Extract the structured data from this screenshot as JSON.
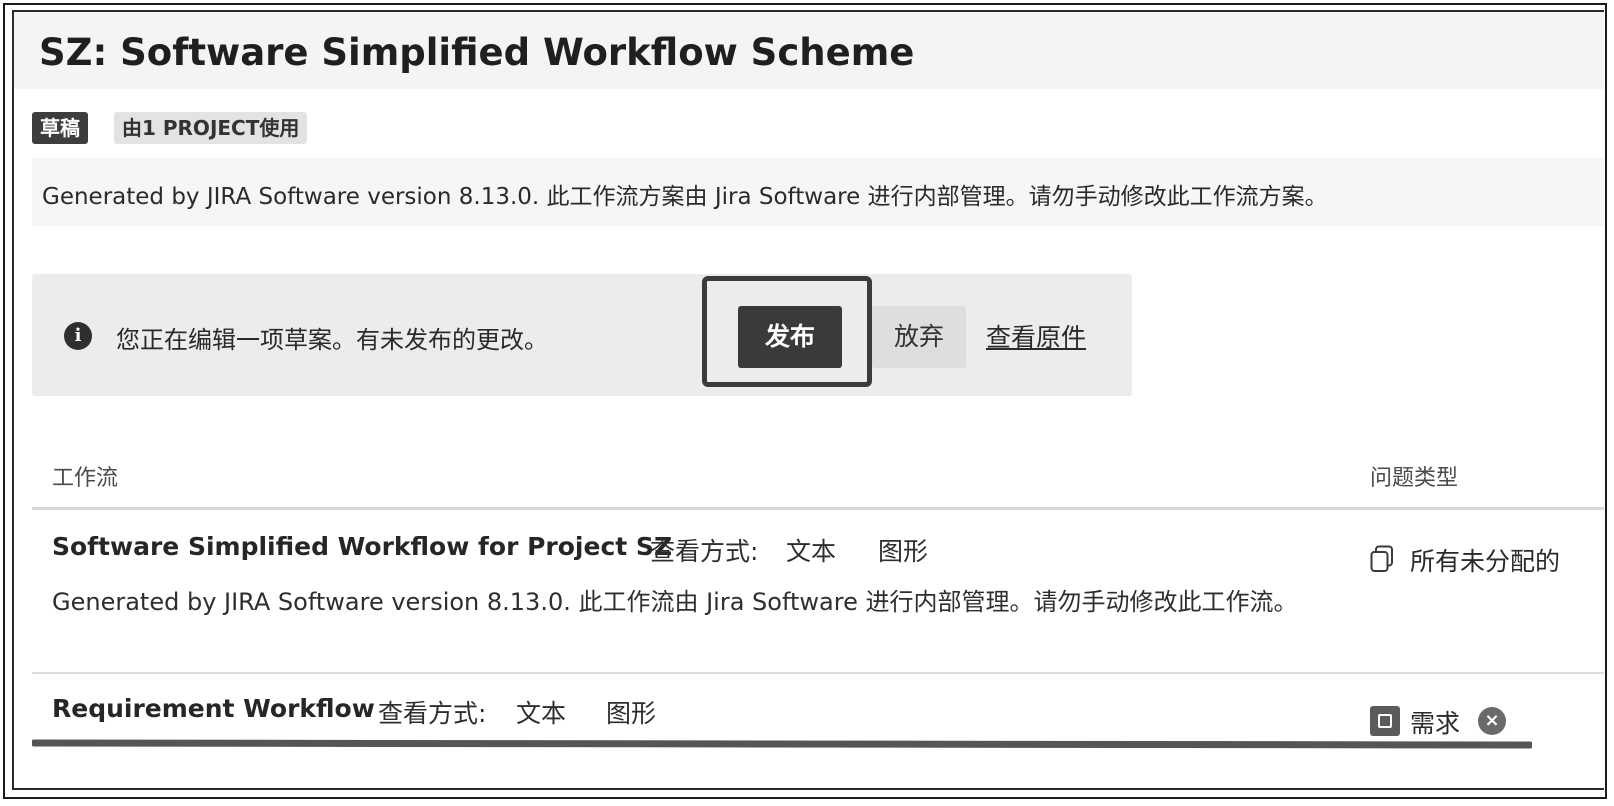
{
  "page": {
    "title": "SZ: Software Simplified Workflow Scheme",
    "badges": {
      "draft": "草稿",
      "usage": "由1 PROJECT使用"
    },
    "description": "Generated by JIRA Software version 8.13.0. 此工作流方案由 Jira Software 进行内部管理。请勿手动修改此工作流方案。"
  },
  "notice": {
    "icon": "info-icon",
    "message": "您正在编辑一项草案。有未发布的更改。",
    "publish_label": "发布",
    "discard_label": "放弃",
    "view_original_label": "查看原件"
  },
  "table": {
    "headers": {
      "workflow": "工作流",
      "issue_types": "问题类型"
    },
    "rows": [
      {
        "name": "Software Simplified Workflow for Project SZ",
        "view_label": "查看方式:",
        "view_text": "文本",
        "view_diagram": "图形",
        "description": "Generated by JIRA Software version 8.13.0. 此工作流由 Jira Software 进行内部管理。请勿手动修改此工作流。",
        "issue_type": "所有未分配的",
        "issue_type_icon": "copy-icon"
      },
      {
        "name": "Requirement Workflow",
        "view_label": "查看方式:",
        "view_text": "文本",
        "view_diagram": "图形",
        "issue_type": "需求",
        "issue_type_icon": "requirement-icon",
        "remove_icon": "remove-icon"
      }
    ]
  },
  "colors": {
    "primary_button": "#3a3a3a",
    "notice_background": "#ececec",
    "title_background": "#f4f4f4"
  }
}
